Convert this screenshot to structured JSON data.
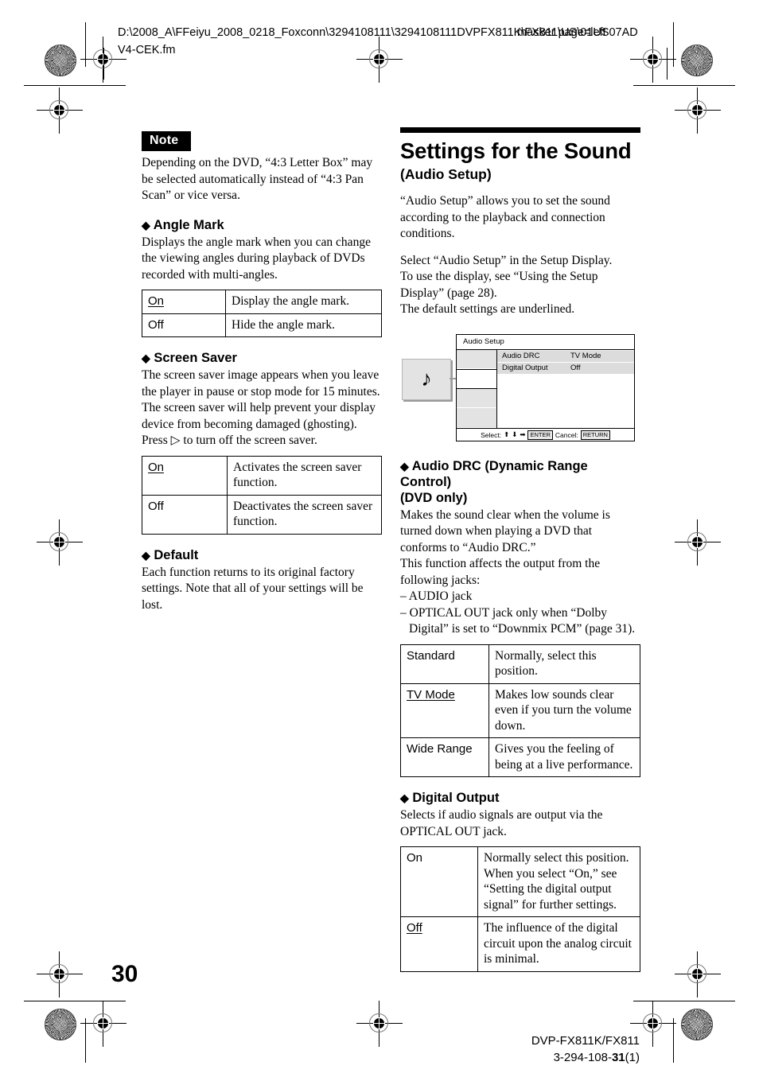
{
  "header": {
    "filepath": "D:\\2008_A\\FFeiyu_2008_0218_Foxconn\\3294108111\\3294108111DVPFX811K\\FX811\\US\\01US07ADV4-CEK.fm",
    "masker_note": "masker page=left"
  },
  "footer": {
    "page_number": "30",
    "model": "DVP-FX811K/FX811",
    "doc_number_prefix": "3-294-108-",
    "doc_number_bold": "31",
    "doc_number_suffix": "(1)"
  },
  "left_column": {
    "note": {
      "label": "Note",
      "body": "Depending on the DVD, “4:3 Letter Box” may be selected automatically instead of “4:3 Pan Scan” or vice versa."
    },
    "angle_mark": {
      "heading": "Angle Mark",
      "body": "Displays the angle mark when you can change the viewing angles during playback of DVDs recorded with multi-angles.",
      "rows": [
        {
          "key": "On",
          "underlined": true,
          "value": "Display the angle mark."
        },
        {
          "key": "Off",
          "underlined": false,
          "value": "Hide the angle mark."
        }
      ]
    },
    "screen_saver": {
      "heading": "Screen Saver",
      "body_part1": "The screen saver image appears when you leave the player in pause or stop mode for 15 minutes. The screen saver will help prevent your display device from becoming damaged (ghosting). Press ",
      "play_icon": "▷",
      "body_part2": " to turn off the screen saver.",
      "rows": [
        {
          "key": "On",
          "underlined": true,
          "value": "Activates the screen saver function."
        },
        {
          "key": "Off",
          "underlined": false,
          "value": "Deactivates the screen saver function."
        }
      ]
    },
    "default_section": {
      "heading": "Default",
      "body": "Each function returns to its original factory settings. Note that all of your settings will be lost."
    }
  },
  "right_column": {
    "title": "Settings for the Sound",
    "subtitle": "(Audio Setup)",
    "intro1": "“Audio Setup” allows you to set the sound according to the playback and connection conditions.",
    "intro2_line1": "Select “Audio Setup” in the Setup Display.",
    "intro2_line2": "To use the display, see “Using the Setup Display” (page 28).",
    "intro2_line3": "The default settings are underlined.",
    "osd": {
      "title": "Audio Setup",
      "icon": "♪",
      "rows": [
        {
          "label": "Audio DRC",
          "value": "TV Mode"
        },
        {
          "label": "Digital Output",
          "value": "Off"
        }
      ],
      "footer_select_label": "Select:",
      "footer_up": "⬆",
      "footer_down": "⬇",
      "footer_right": "➡",
      "footer_enter_key": "ENTER",
      "footer_cancel_label": "Cancel:",
      "footer_return_key": "RETURN"
    },
    "audio_drc": {
      "heading_line1": "Audio DRC (Dynamic Range Control)",
      "heading_line2": "(DVD only)",
      "body1": "Makes the sound clear when the volume is turned down when playing a DVD that conforms to “Audio DRC.”",
      "body2": "This function affects the output from the following jacks:",
      "bullet1": "– AUDIO jack",
      "bullet2": "– OPTICAL OUT jack only when “Dolby Digital” is set to “Downmix PCM” (page 31).",
      "rows": [
        {
          "key": "Standard",
          "underlined": false,
          "value": "Normally, select this position."
        },
        {
          "key": "TV Mode",
          "underlined": true,
          "value": "Makes low sounds clear even if you turn the volume down."
        },
        {
          "key": "Wide Range",
          "underlined": false,
          "value": "Gives you the feeling of being at a live performance."
        }
      ]
    },
    "digital_output": {
      "heading": "Digital Output",
      "body": "Selects if audio signals are output via the OPTICAL OUT jack.",
      "rows": [
        {
          "key": "On",
          "underlined": false,
          "value": "Normally select this position. When you select “On,” see “Setting the digital output signal” for further settings."
        },
        {
          "key": "Off",
          "underlined": true,
          "value": "The influence of the digital circuit upon the analog circuit is minimal."
        }
      ]
    }
  }
}
